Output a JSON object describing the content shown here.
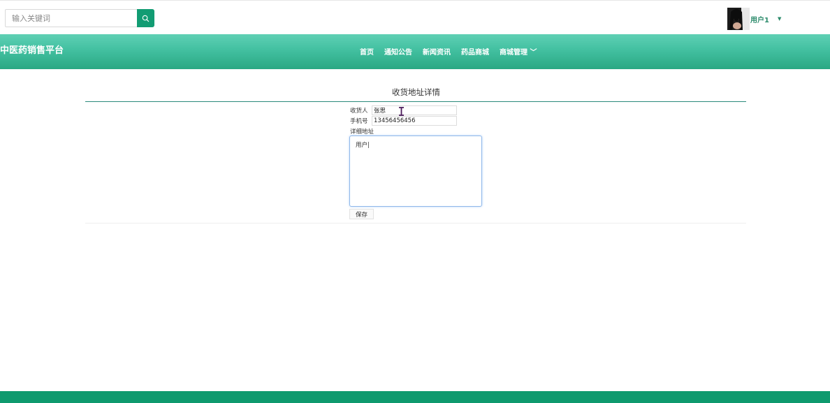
{
  "header": {
    "search": {
      "placeholder": "输入关键词",
      "icon": "search-icon"
    },
    "user": {
      "name": "用户1",
      "avatar_icon": "avatar-photo",
      "caret_icon": "caret-down-icon"
    }
  },
  "navbar": {
    "brand": "中医药销售平台",
    "items": [
      {
        "label": "首页"
      },
      {
        "label": "通知公告"
      },
      {
        "label": "新闻资讯"
      },
      {
        "label": "药品商城"
      },
      {
        "label": "商城管理 ﹀"
      }
    ]
  },
  "form": {
    "title": "收货地址详情",
    "receiver": {
      "label": "收货人",
      "value": "张思"
    },
    "phone": {
      "label": "手机号",
      "value": "13456456456"
    },
    "address": {
      "label": "详细地址",
      "value": "用户|"
    },
    "save_label": "保存"
  },
  "colors": {
    "brand_green": "#129c73",
    "nav_gradient_top": "#5fd0b4",
    "nav_gradient_bottom": "#2aa883",
    "footer": "#0e9a6e"
  }
}
